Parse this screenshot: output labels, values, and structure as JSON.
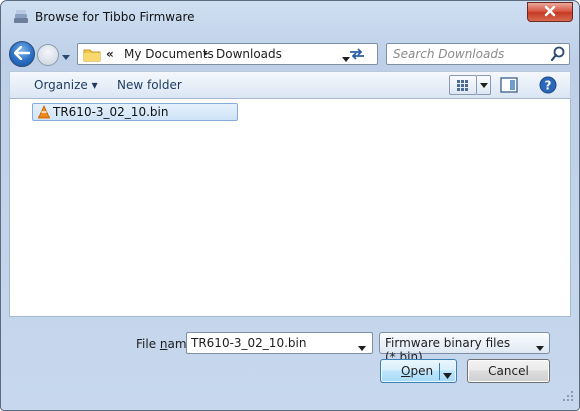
{
  "window": {
    "title": "Browse for Tibbo Firmware",
    "icon": "tibbo-app-icon",
    "close_icon": "close-icon"
  },
  "address": {
    "chevrons": "«",
    "breadcrumbs": [
      "My Documents",
      "Downloads"
    ],
    "separator": "▸"
  },
  "search": {
    "placeholder": "Search Downloads"
  },
  "toolbar": {
    "organize": "Organize ▾",
    "new_folder": "New folder"
  },
  "files": [
    {
      "name": "TR610-3_02_10.bin",
      "icon": "vlc-cone-icon",
      "selected": true
    }
  ],
  "bottom": {
    "file_name_label_pre": "File ",
    "file_name_label_u": "n",
    "file_name_label_post": "ame:",
    "file_name_value": "TR610-3_02_10.bin",
    "file_type": "Firmware binary files (*.bin)",
    "open_u": "O",
    "open_rest": "pen",
    "cancel": "Cancel"
  },
  "colors": {
    "accent": "#2a6fc4",
    "selection": "#cfe3f8",
    "close": "#c33a23"
  }
}
